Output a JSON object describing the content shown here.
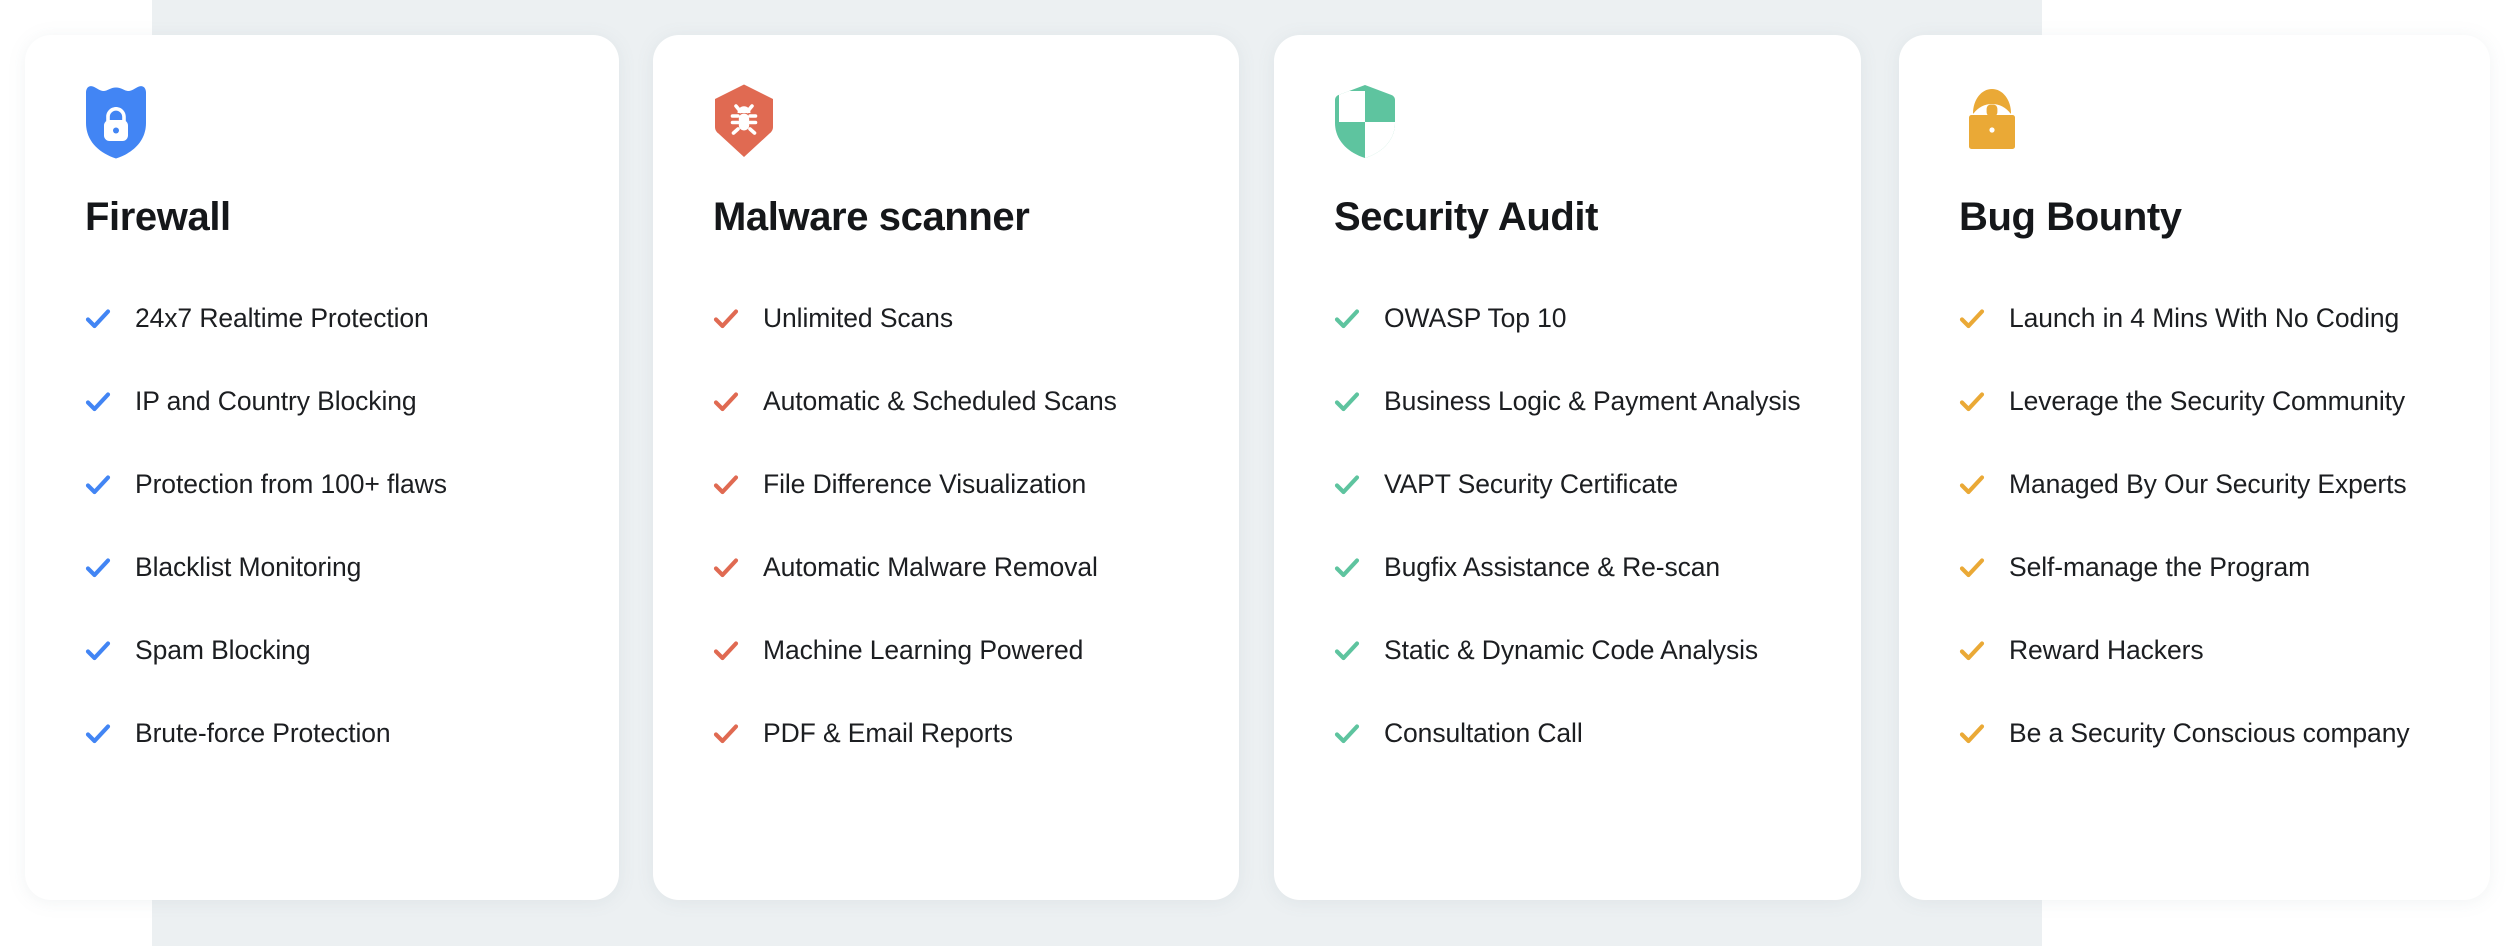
{
  "background": {
    "page_color": "#ffffff",
    "band_color": "#ecf0f2"
  },
  "cards": [
    {
      "id": "firewall",
      "title": "Firewall",
      "icon": "shield-lock-icon",
      "accent": "#4285f4",
      "features": [
        "24x7 Realtime Protection",
        "IP and Country Blocking",
        "Protection from 100+ flaws",
        "Blacklist Monitoring",
        "Spam Blocking",
        "Brute-force Protection"
      ]
    },
    {
      "id": "malware-scanner",
      "title": "Malware scanner",
      "icon": "shield-bug-icon",
      "accent": "#e06a52",
      "features": [
        "Unlimited Scans",
        "Automatic & Scheduled Scans",
        "File Difference Visualization",
        "Automatic Malware Removal",
        "Machine Learning Powered",
        "PDF & Email Reports"
      ]
    },
    {
      "id": "security-audit",
      "title": "Security Audit",
      "icon": "shield-quartered-icon",
      "accent": "#5ec49f",
      "features": [
        "OWASP Top 10",
        "Business Logic & Payment Analysis",
        "VAPT Security Certificate",
        "Bugfix Assistance & Re-scan",
        "Static & Dynamic Code Analysis",
        "Consultation Call"
      ]
    },
    {
      "id": "bug-bounty",
      "title": "Bug Bounty",
      "icon": "hacker-laptop-icon",
      "accent": "#eaa936",
      "features": [
        "Launch in 4 Mins With No Coding",
        "Leverage the Security Community",
        "Managed By Our Security Experts",
        "Self-manage the Program",
        "Reward Hackers",
        "Be a Security Conscious company"
      ]
    }
  ]
}
